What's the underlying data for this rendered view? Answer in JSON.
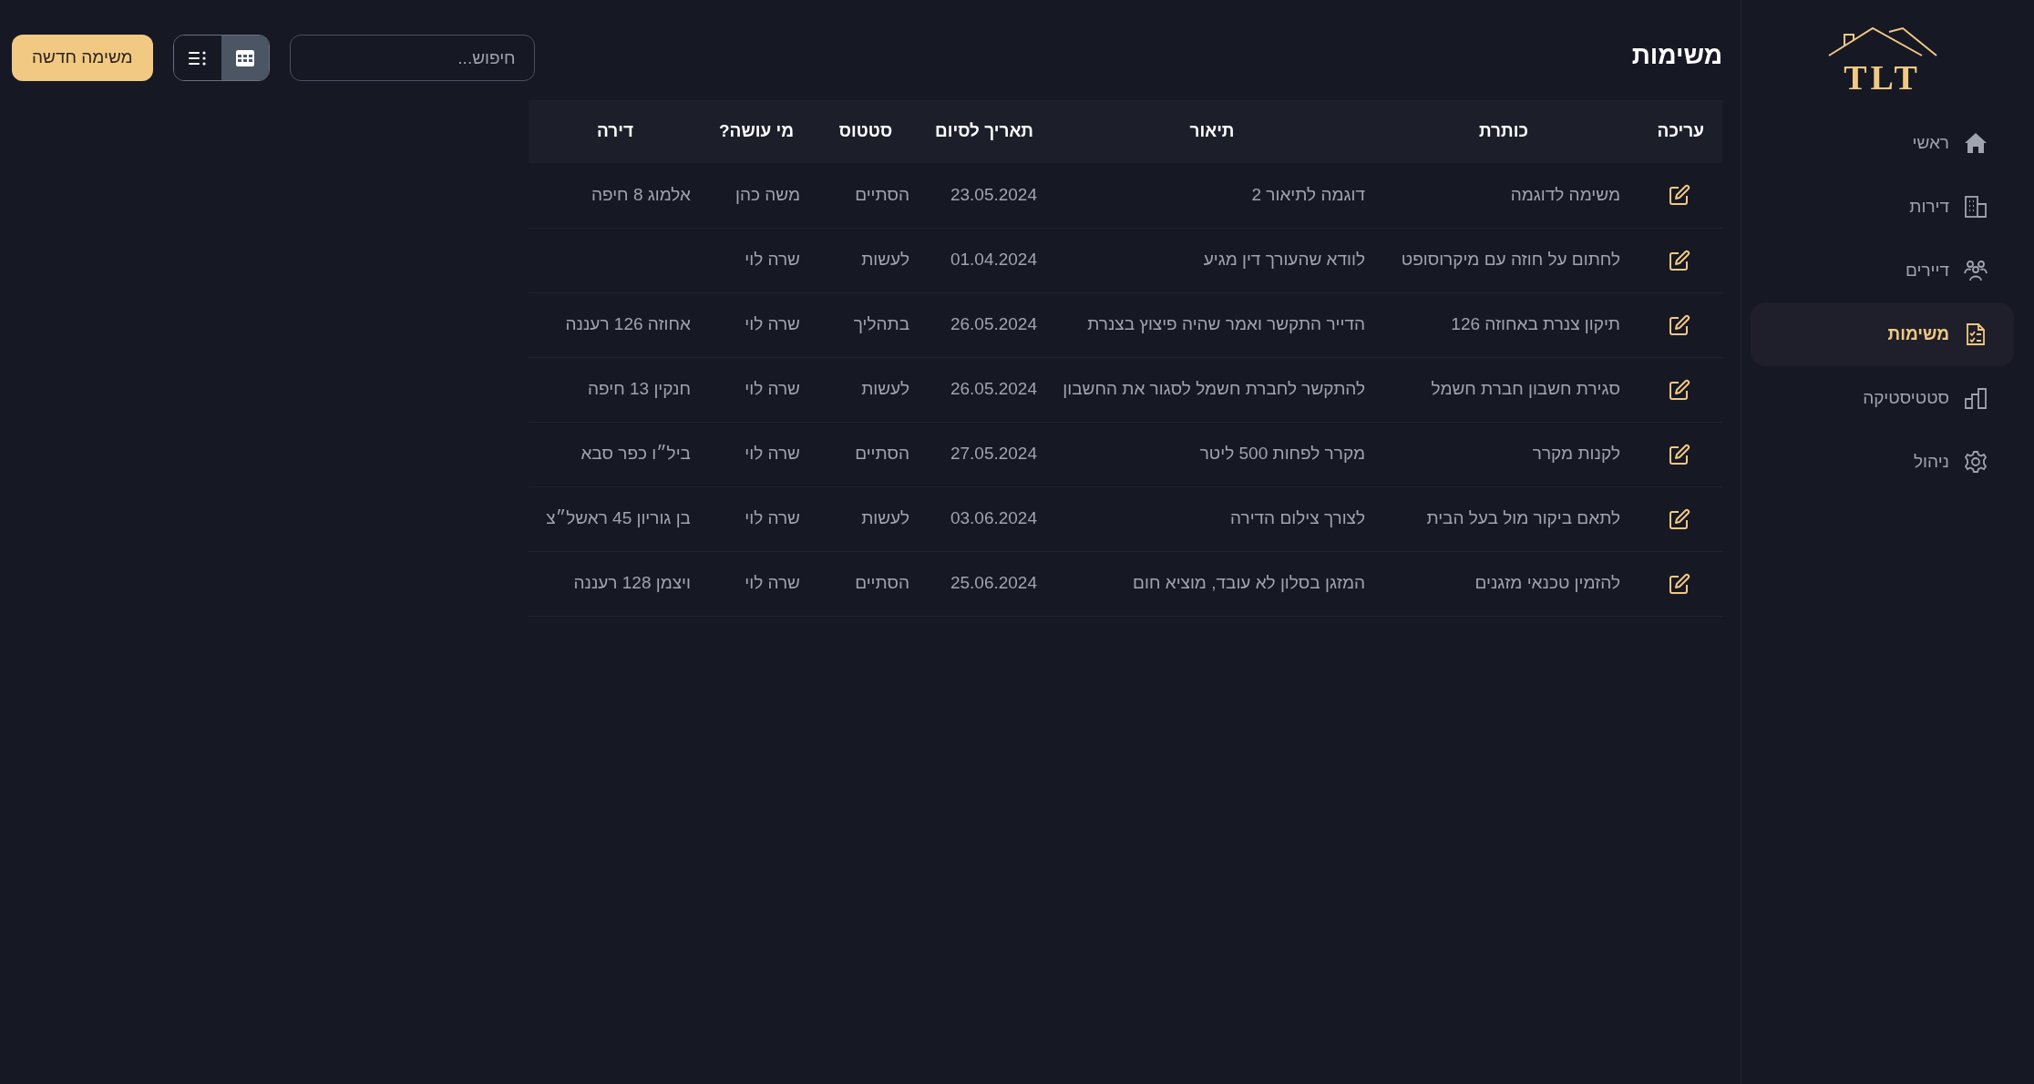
{
  "sidebar": {
    "logo": "TLT",
    "items": [
      {
        "label": "ראשי",
        "selected": false
      },
      {
        "label": "דירות",
        "selected": false
      },
      {
        "label": "דיירים",
        "selected": false
      },
      {
        "label": "משימות",
        "selected": true
      },
      {
        "label": "סטטיסטיקה",
        "selected": false
      },
      {
        "label": "ניהול",
        "selected": false
      }
    ]
  },
  "page_title": "משימות",
  "toolbar": {
    "search": {
      "placeholder": "חיפוש..."
    },
    "view_toggle": [
      {
        "kind": "table",
        "selected": true
      },
      {
        "kind": "list",
        "selected": false
      }
    ],
    "new_button": "משימה חדשה"
  },
  "table": {
    "columns": [
      "עריכה",
      "כותרת",
      "תיאור",
      "תאריך לסיום",
      "סטטוס",
      "מי עושה?",
      "דירה"
    ],
    "rows": [
      {
        "title": "משימה לדוגמה",
        "description": "דוגמה לתיאור 2",
        "due_date": "23.05.2024",
        "status": "הסתיים",
        "assignee": "משה כהן",
        "apartment": "אלמוג 8 חיפה"
      },
      {
        "title": "לחתום על חוזה עם מיקרוסופט",
        "description": "לוודא שהעורך דין מגיע",
        "due_date": "01.04.2024",
        "status": "לעשות",
        "assignee": "שרה לוי"
      },
      {
        "title": "תיקון צנרת באחוזה 126",
        "description": "הדייר התקשר ואמר שהיה פיצוץ בצנרת",
        "due_date": "26.05.2024",
        "status": "בתהליך",
        "assignee": "שרה לוי",
        "apartment": "אחוזה 126 רעננה"
      },
      {
        "title": "סגירת חשבון חברת חשמל",
        "description": "להתקשר לחברת חשמל לסגור את החשבון",
        "due_date": "26.05.2024",
        "status": "לעשות",
        "assignee": "שרה לוי",
        "apartment": "חנקין 13 חיפה"
      },
      {
        "title": "לקנות מקרר",
        "description": "מקרר לפחות 500 ליטר",
        "due_date": "27.05.2024",
        "status": "הסתיים",
        "assignee": "שרה לוי",
        "apartment": "ביל״ו כפר סבא"
      },
      {
        "title": "לתאם ביקור מול בעל הבית",
        "description": "לצורך צילום הדירה",
        "due_date": "03.06.2024",
        "status": "לעשות",
        "assignee": "שרה לוי",
        "apartment": "בן גוריון 45 ראשל״צ"
      },
      {
        "title": "להזמין טכנאי מזגנים",
        "description": "המזגן בסלון לא עובד, מוציא חום",
        "due_date": "25.06.2024",
        "status": "הסתיים",
        "assignee": "שרה לוי",
        "apartment": "ויצמן 128 רעננה"
      }
    ]
  }
}
